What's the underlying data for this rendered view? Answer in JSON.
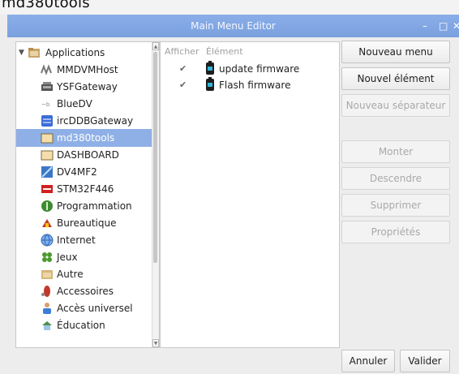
{
  "background": {
    "partial_text": "md380tools"
  },
  "window": {
    "title": "Main Menu Editor",
    "minimize": "–",
    "maximize": "□",
    "close": "✕"
  },
  "tree": {
    "items": [
      {
        "label": "Applications",
        "icon": "applications-folder-icon",
        "expanded": true
      },
      {
        "label": "MMDVMHost",
        "icon": "mmdvm-icon"
      },
      {
        "label": "YSFGateway",
        "icon": "ysf-icon"
      },
      {
        "label": "BlueDV",
        "icon": "bluedv-icon"
      },
      {
        "label": "ircDDBGateway",
        "icon": "irc-icon"
      },
      {
        "label": "md380tools",
        "icon": "folder-icon",
        "selected": true
      },
      {
        "label": "DASHBOARD",
        "icon": "folder-icon"
      },
      {
        "label": "DV4MF2",
        "icon": "dv4mf2-icon"
      },
      {
        "label": "STM32F446",
        "icon": "stm-icon"
      },
      {
        "label": "Programmation",
        "icon": "programming-icon"
      },
      {
        "label": "Bureautique",
        "icon": "office-icon"
      },
      {
        "label": "Internet",
        "icon": "globe-icon"
      },
      {
        "label": "Jeux",
        "icon": "games-icon"
      },
      {
        "label": "Autre",
        "icon": "other-folder-icon"
      },
      {
        "label": "Accessoires",
        "icon": "accessories-icon"
      },
      {
        "label": "Accès universel",
        "icon": "accessibility-icon"
      },
      {
        "label": "Éducation",
        "icon": "education-icon"
      }
    ]
  },
  "items_panel": {
    "headers": {
      "show": "Afficher",
      "element": "Élément"
    },
    "rows": [
      {
        "name": "update firmware",
        "checked": "✔"
      },
      {
        "name": "Flash firmware",
        "checked": "✔"
      }
    ]
  },
  "buttons": {
    "new_menu": "Nouveau menu",
    "new_item": "Nouvel élément",
    "new_separator": "Nouveau séparateur",
    "move_up": "Monter",
    "move_down": "Descendre",
    "delete": "Supprimer",
    "properties": "Propriétés",
    "cancel": "Annuler",
    "ok": "Valider"
  },
  "colors": {
    "titlebar": "#7ea3e0",
    "selection": "#8fb0e6"
  }
}
